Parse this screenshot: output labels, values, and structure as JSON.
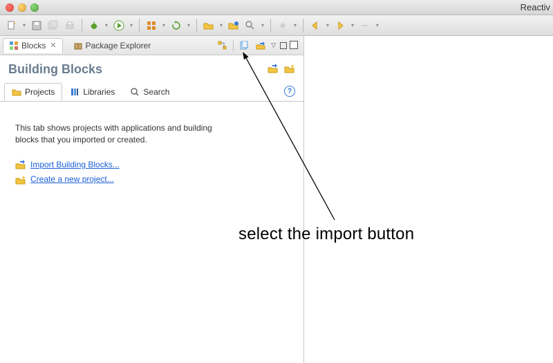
{
  "window": {
    "title_right": "Reactiv"
  },
  "view_tabs": {
    "active": {
      "label": "Blocks"
    },
    "other": {
      "label": "Package Explorer"
    }
  },
  "panel": {
    "title": "Building Blocks"
  },
  "subtabs": {
    "projects": "Projects",
    "libraries": "Libraries",
    "search": "Search"
  },
  "projects_tab": {
    "desc": "This tab shows projects with applications and building blocks that you imported or created.",
    "link_import": "Import Building Blocks...",
    "link_newproj": "Create a new project..."
  },
  "annotation": {
    "text": "select the import button"
  },
  "icons": {
    "blocks": "blocks-icon",
    "pkg": "package-icon",
    "import": "import-icon",
    "copy": "copy-icon",
    "tree": "tree-icon",
    "folder": "folder-icon",
    "books": "books-icon",
    "search": "search-icon",
    "newproj": "newproj-icon"
  }
}
